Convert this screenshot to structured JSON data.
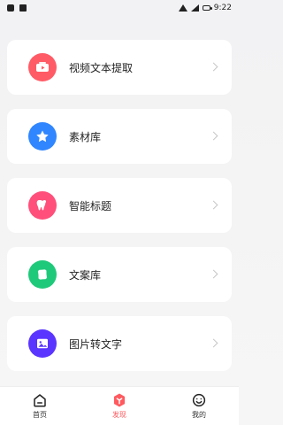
{
  "status_bar": {
    "time": "9:22"
  },
  "cards": [
    {
      "label": "视频文本提取",
      "icon": "video-icon",
      "accent": "#ff5b66"
    },
    {
      "label": "素材库",
      "icon": "star-icon",
      "accent": "#2f86ff"
    },
    {
      "label": "智能标题",
      "icon": "tooth-icon",
      "accent": "#ff4f7a"
    },
    {
      "label": "文案库",
      "icon": "cards-icon",
      "accent": "#1fc97a"
    },
    {
      "label": "图片转文字",
      "icon": "image-icon",
      "accent": "#5a35ff"
    }
  ],
  "bottom_nav": [
    {
      "label": "首页",
      "icon": "home-icon"
    },
    {
      "label": "发现",
      "icon": "discover-icon",
      "active": true
    },
    {
      "label": "我的",
      "icon": "profile-icon"
    }
  ],
  "colors": {
    "active": "#ff5a5f"
  }
}
